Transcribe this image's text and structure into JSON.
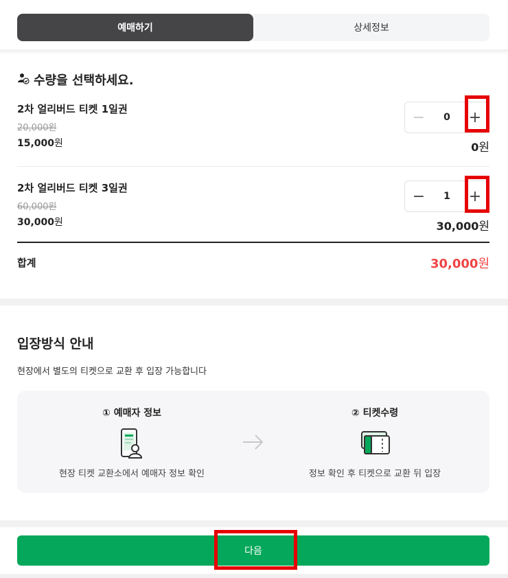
{
  "tabs": [
    {
      "label": "예매하기",
      "active": true
    },
    {
      "label": "상세정보",
      "active": false
    }
  ],
  "selection": {
    "title": "수량을 선택하세요.",
    "items": [
      {
        "name": "2차 얼리버드 티켓 1일권",
        "original_price": "20,000원",
        "price": "15,000",
        "quantity": "0",
        "subtotal": "0"
      },
      {
        "name": "2차 얼리버드 티켓 3일권",
        "original_price": "60,000원",
        "price": "30,000",
        "quantity": "1",
        "subtotal": "30,000"
      }
    ],
    "currency": "원",
    "minus": "−",
    "plus": "+"
  },
  "total": {
    "label": "합계",
    "value": "30,000"
  },
  "guide": {
    "title": "입장방식 안내",
    "description": "현장에서 별도의 티켓으로 교환 후 입장 가능합니다",
    "steps": [
      {
        "title": "① 예매자 정보",
        "description": "현장 티켓 교환소에서 예매자 정보 확인",
        "icon": "phone-person-icon"
      },
      {
        "title": "② 티켓수령",
        "description": "정보 확인 후 티켓으로 교환 뒤 입장",
        "icon": "tickets-icon"
      }
    ]
  },
  "next_button": {
    "label": "다음"
  },
  "colors": {
    "accent_green": "#05a85a",
    "tab_active": "#454548",
    "total_red": "#ef4444",
    "highlight": "#e60000"
  }
}
